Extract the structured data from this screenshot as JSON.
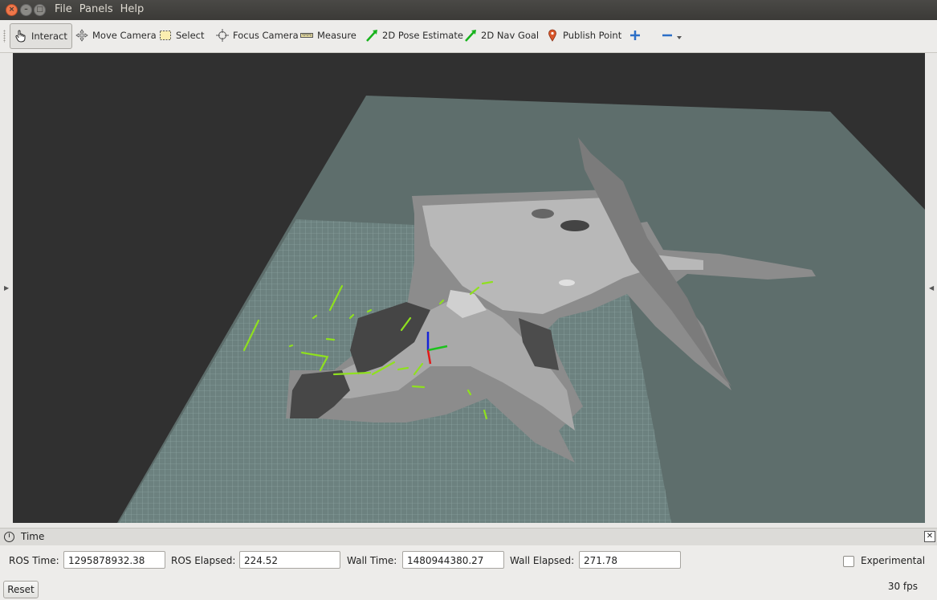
{
  "titlebar": {
    "menu": [
      "File",
      "Panels",
      "Help"
    ]
  },
  "toolbar": {
    "tools": [
      {
        "label": "Interact",
        "icon": "hand-cursor-icon"
      },
      {
        "label": "Move Camera",
        "icon": "move-camera-icon"
      },
      {
        "label": "Select",
        "icon": "select-rect-icon"
      },
      {
        "label": "Focus Camera",
        "icon": "focus-camera-icon"
      },
      {
        "label": "Measure",
        "icon": "ruler-icon"
      },
      {
        "label": "2D Pose Estimate",
        "icon": "green-arrow-icon"
      },
      {
        "label": "2D Nav Goal",
        "icon": "green-arrow-icon"
      },
      {
        "label": "Publish Point",
        "icon": "map-pin-icon"
      }
    ],
    "add_icon": "plus-icon",
    "remove_icon": "minus-icon",
    "dropdown_icon": "chevron-down-icon"
  },
  "time_panel": {
    "title": "Time",
    "ros_time_label": "ROS Time:",
    "ros_time": "1295878932.38",
    "ros_elapsed_label": "ROS Elapsed:",
    "ros_elapsed": "224.52",
    "wall_time_label": "Wall Time:",
    "wall_time": "1480944380.27",
    "wall_elapsed_label": "Wall Elapsed:",
    "wall_elapsed": "271.78",
    "experimental_label": "Experimental"
  },
  "status": {
    "reset_label": "Reset",
    "fps": "30 fps"
  },
  "colors": {
    "accent_green": "#8fe01f",
    "grid_plane": "#5e6e6c",
    "background": "#303030"
  }
}
